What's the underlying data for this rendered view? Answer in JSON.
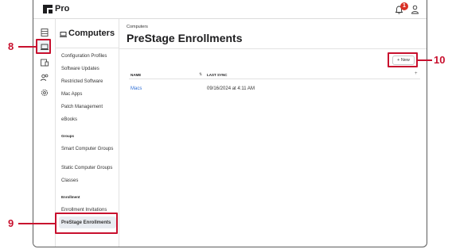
{
  "app": {
    "name": "Pro",
    "notification_count": "1"
  },
  "rail": {
    "items": [
      {
        "icon": "dashboard-icon"
      },
      {
        "icon": "computer-icon",
        "selected": true
      },
      {
        "icon": "devices-icon"
      },
      {
        "icon": "users-icon"
      },
      {
        "icon": "settings-icon"
      }
    ]
  },
  "subnav": {
    "title": "Computers",
    "items": [
      "Configuration Profiles",
      "Software Updates",
      "Restricted Software",
      "Mac Apps",
      "Patch Management",
      "eBooks"
    ],
    "groups_heading": "Groups",
    "groups_items": [
      "Smart Computer Groups",
      "Static Computer Groups",
      "Classes"
    ],
    "enrollment_heading": "Enrollment",
    "enrollment_items": [
      "Enrollment Invitations",
      "PreStage Enrollments"
    ]
  },
  "main": {
    "breadcrumb": "Computers",
    "title": "PreStage Enrollments",
    "new_button": "+ New",
    "columns": {
      "name": "NAME",
      "last_sync": "LAST SYNC"
    },
    "rows": [
      {
        "name": "Macs",
        "last_sync": "09/16/2024 at 4:11 AM"
      }
    ]
  },
  "callouts": {
    "rail_computers": "8",
    "prestage": "9",
    "new": "10"
  },
  "colors": {
    "callout": "#c8102e",
    "link": "#2f6fd6",
    "badge": "#d93025"
  }
}
